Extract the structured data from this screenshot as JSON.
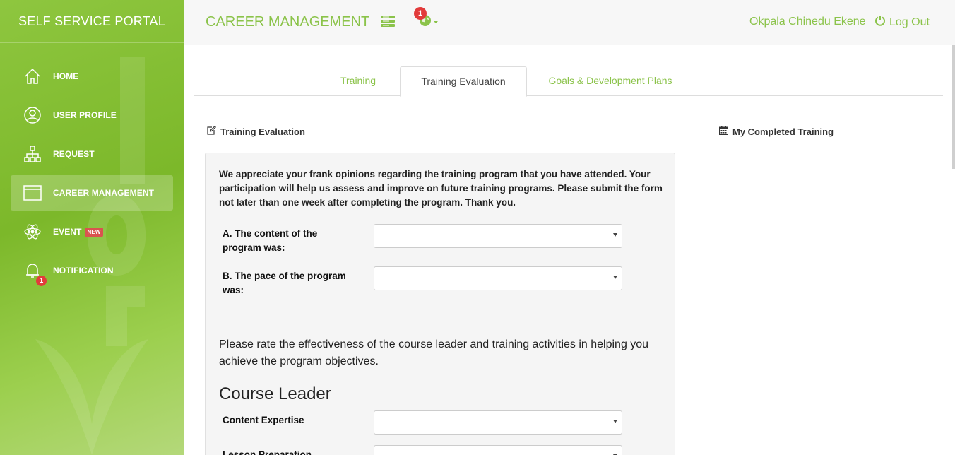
{
  "sidebar": {
    "brand": "SELF SERVICE PORTAL",
    "items": [
      {
        "label": "HOME",
        "icon": "home-icon",
        "active": false
      },
      {
        "label": "USER PROFILE",
        "icon": "user-circle-icon",
        "active": false
      },
      {
        "label": "REQUEST",
        "icon": "sitemap-icon",
        "active": false
      },
      {
        "label": "CAREER MANAGEMENT",
        "icon": "window-icon",
        "active": true
      },
      {
        "label": "EVENT",
        "icon": "atom-icon",
        "badge": "NEW",
        "active": false
      },
      {
        "label": "NOTIFICATION",
        "icon": "bell-icon",
        "count": "1",
        "active": false
      }
    ]
  },
  "header": {
    "title": "CAREER MANAGEMENT",
    "notification_count": "1",
    "user_name": "Okpala Chinedu Ekene",
    "logout_label": "Log Out"
  },
  "tabs": [
    {
      "label": "Training",
      "active": false
    },
    {
      "label": "Training Evaluation",
      "active": true
    },
    {
      "label": "Goals & Development Plans",
      "active": false
    }
  ],
  "evaluation": {
    "heading": "Training Evaluation",
    "intro": "We appreciate your frank opinions regarding the training program that you have attended. Your participation will help us assess and improve on future training programs. Please submit the form not later than one week after completing the program. Thank you.",
    "question_a": "A. The content of the program was:",
    "question_b": "B. The pace of the program was:",
    "rate_text": "Please rate the effectiveness of the course leader and training activities in helping you achieve the program objectives.",
    "course_leader_heading": "Course Leader",
    "content_expertise_label": "Content Expertise",
    "lesson_preparation_label": "Lesson Preparation"
  },
  "completed": {
    "heading": "My Completed Training"
  },
  "colors": {
    "accent": "#8bc34a",
    "sidebar_green": "#7cb82a",
    "badge_red": "#e23b3b"
  }
}
